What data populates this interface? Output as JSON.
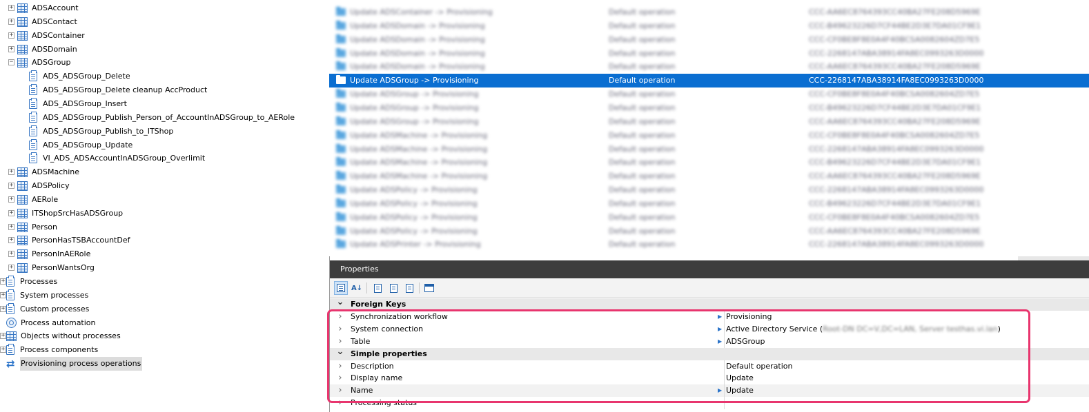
{
  "tree": {
    "items": [
      {
        "label": "ADSAccount",
        "type": "table",
        "expander": "+",
        "indent": 0
      },
      {
        "label": "ADSContact",
        "type": "table",
        "expander": "+",
        "indent": 0
      },
      {
        "label": "ADSContainer",
        "type": "table",
        "expander": "+",
        "indent": 0
      },
      {
        "label": "ADSDomain",
        "type": "table",
        "expander": "+",
        "indent": 0
      },
      {
        "label": "ADSGroup",
        "type": "table",
        "expander": "-",
        "indent": 0
      },
      {
        "label": "ADS_ADSGroup_Delete",
        "type": "process",
        "expander": "",
        "indent": 1
      },
      {
        "label": "ADS_ADSGroup_Delete cleanup AccProduct",
        "type": "process",
        "expander": "",
        "indent": 1
      },
      {
        "label": "ADS_ADSGroup_Insert",
        "type": "process",
        "expander": "",
        "indent": 1
      },
      {
        "label": "ADS_ADSGroup_Publish_Person_of_AccountInADSGroup_to_AERole",
        "type": "process",
        "expander": "",
        "indent": 1
      },
      {
        "label": "ADS_ADSGroup_Publish_to_ITShop",
        "type": "process",
        "expander": "",
        "indent": 1
      },
      {
        "label": "ADS_ADSGroup_Update",
        "type": "process",
        "expander": "",
        "indent": 1
      },
      {
        "label": "VI_ADS_ADSAccountInADSGroup_Overlimit",
        "type": "process",
        "expander": "",
        "indent": 1
      },
      {
        "label": "ADSMachine",
        "type": "table",
        "expander": "+",
        "indent": 0
      },
      {
        "label": "ADSPolicy",
        "type": "table",
        "expander": "+",
        "indent": 0
      },
      {
        "label": "AERole",
        "type": "table",
        "expander": "+",
        "indent": 0
      },
      {
        "label": "ITShopSrcHasADSGroup",
        "type": "table",
        "expander": "+",
        "indent": 0
      },
      {
        "label": "Person",
        "type": "table",
        "expander": "+",
        "indent": 0
      },
      {
        "label": "PersonHasTSBAccountDef",
        "type": "table",
        "expander": "+",
        "indent": 0
      },
      {
        "label": "PersonInAERole",
        "type": "table",
        "expander": "+",
        "indent": 0
      },
      {
        "label": "PersonWantsOrg",
        "type": "table",
        "expander": "+",
        "indent": 0
      },
      {
        "label": "Processes",
        "type": "process",
        "expander": "+",
        "indent": -1
      },
      {
        "label": "System processes",
        "type": "process",
        "expander": "+",
        "indent": -1
      },
      {
        "label": "Custom processes",
        "type": "process",
        "expander": "+",
        "indent": -1
      },
      {
        "label": "Process automation",
        "type": "gear",
        "expander": "",
        "indent": -1
      },
      {
        "label": "Objects without processes",
        "type": "table",
        "expander": "+",
        "indent": -1
      },
      {
        "label": "Process components",
        "type": "process",
        "expander": "+",
        "indent": -1
      },
      {
        "label": "Provisioning process operations",
        "type": "cycle",
        "expander": "",
        "indent": -1,
        "selected": true
      }
    ]
  },
  "grid": {
    "rows": [
      {
        "name": "Update ADSContainer -> Provisioning",
        "op": "Default operation",
        "uid": "CCC-AA6EC8764393CC40BA27FE208D5969E",
        "blur": true
      },
      {
        "name": "Update ADSDomain -> Provisioning",
        "op": "Default operation",
        "uid": "CCC-B49623226D7CF44BE2D3E7DA01CF9E1",
        "blur": true
      },
      {
        "name": "Update ADSDomain -> Provisioning",
        "op": "Default operation",
        "uid": "CCC-CF0BE8F8E0A4F40BCSA0082604ZD7E5",
        "blur": true
      },
      {
        "name": "Update ADSDomain -> Provisioning",
        "op": "Default operation",
        "uid": "CCC-2268147ABA38914FA8EC0993263D0000",
        "blur": true
      },
      {
        "name": "Update ADSDomain -> Provisioning",
        "op": "Default operation",
        "uid": "CCC-AA6EC8764393CC40BA27FE208D5969E",
        "blur": true
      },
      {
        "name": "Update ADSGroup -> Provisioning",
        "op": "Default operation",
        "uid": "CCC-2268147ABA38914FA8EC0993263D0000",
        "blur": false,
        "selected": true
      },
      {
        "name": "Update ADSGroup -> Provisioning",
        "op": "Default operation",
        "uid": "CCC-CF0BE8F8E0A4F40BCSA0082604ZD7E5",
        "blur": true
      },
      {
        "name": "Update ADSGroup -> Provisioning",
        "op": "Default operation",
        "uid": "CCC-B49623226D7CF44BE2D3E7DA01CF9E1",
        "blur": true
      },
      {
        "name": "Update ADSGroup -> Provisioning",
        "op": "Default operation",
        "uid": "CCC-AA6EC8764393CC40BA27FE208D5969E",
        "blur": true
      },
      {
        "name": "Update ADSMachine -> Provisioning",
        "op": "Default operation",
        "uid": "CCC-CF0BE8F8E0A4F40BCSA0082604ZD7E5",
        "blur": true
      },
      {
        "name": "Update ADSMachine -> Provisioning",
        "op": "Default operation",
        "uid": "CCC-2268147ABA38914FA8EC0993263D0000",
        "blur": true
      },
      {
        "name": "Update ADSMachine -> Provisioning",
        "op": "Default operation",
        "uid": "CCC-B49623226D7CF44BE2D3E7DA01CF9E1",
        "blur": true
      },
      {
        "name": "Update ADSMachine -> Provisioning",
        "op": "Default operation",
        "uid": "CCC-AA6EC8764393CC40BA27FE208D5969E",
        "blur": true
      },
      {
        "name": "Update ADSPolicy -> Provisioning",
        "op": "Default operation",
        "uid": "CCC-2268147ABA38914FA8EC0993263D0000",
        "blur": true
      },
      {
        "name": "Update ADSPolicy -> Provisioning",
        "op": "Default operation",
        "uid": "CCC-B49623226D7CF44BE2D3E7DA01CF9E1",
        "blur": true
      },
      {
        "name": "Update ADSPolicy -> Provisioning",
        "op": "Default operation",
        "uid": "CCC-CF0BE8F8E0A4F40BCSA0082604ZD7E5",
        "blur": true
      },
      {
        "name": "Update ADSPolicy -> Provisioning",
        "op": "Default operation",
        "uid": "CCC-AA6EC8764393CC40BA27FE208D5969E",
        "blur": true
      },
      {
        "name": "Update ADSPrinter -> Provisioning",
        "op": "Default operation",
        "uid": "CCC-2268147ABA38914FA8EC0993263D0000",
        "blur": true
      }
    ]
  },
  "properties": {
    "title": "Properties",
    "toolbar": [
      "categorized-icon",
      "sort-az-icon",
      "property-page-icon",
      "events-icon",
      "page-icon",
      "window-icon"
    ],
    "rows": [
      {
        "kind": "cat",
        "name": "Foreign Keys"
      },
      {
        "kind": "prop",
        "name": "Synchronization workflow",
        "value": "Provisioning",
        "arrow": true
      },
      {
        "kind": "prop",
        "name": "System connection",
        "value": "Active Directory Service (",
        "value_hidden": "Root-DN DC=V,DC=LAN, Server testhas.vi.lan",
        "value_tail": ")",
        "arrow": true
      },
      {
        "kind": "prop",
        "name": "Table",
        "value": "ADSGroup",
        "arrow": true
      },
      {
        "kind": "cat",
        "name": "Simple properties"
      },
      {
        "kind": "prop",
        "name": "Description",
        "value": "Default operation",
        "arrow": false
      },
      {
        "kind": "prop",
        "name": "Display name",
        "value": "Update",
        "arrow": false
      },
      {
        "kind": "prop",
        "name": "Name",
        "value": "Update",
        "arrow": true,
        "alt": true
      },
      {
        "kind": "prop",
        "name": "Processing status",
        "value": "",
        "arrow": false
      }
    ]
  },
  "colors": {
    "selection": "#0a6ed1",
    "highlight_border": "#e8356e",
    "props_header": "#3d3d3d"
  }
}
